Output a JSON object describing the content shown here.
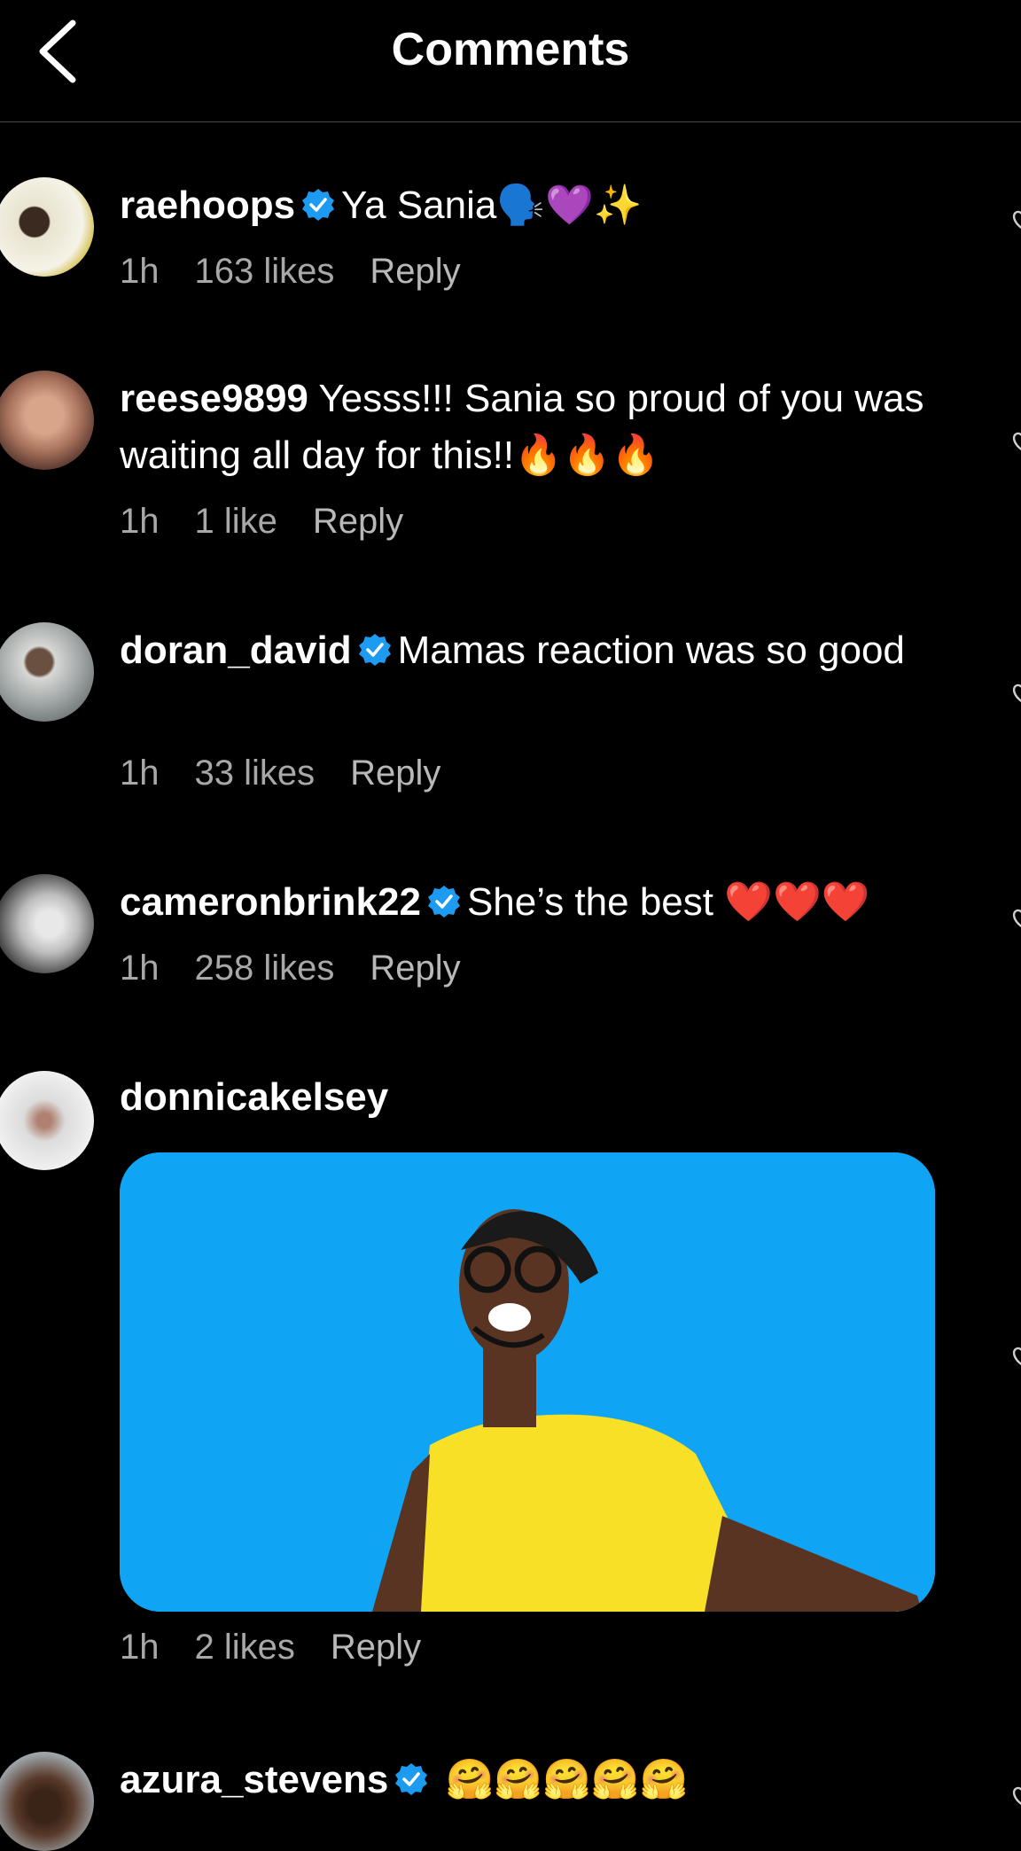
{
  "header": {
    "title": "Comments"
  },
  "comments": [
    {
      "username": "raehoops",
      "text": "Ya Sania",
      "emojis": "🗣️💜✨",
      "time": "1h",
      "likes": "163 likes",
      "reply": "Reply",
      "verified": true
    },
    {
      "username": "reese9899",
      "text": "Yesss!!! Sania so proud of you was waiting all day for this!!",
      "emojis": "🔥🔥🔥",
      "time": "1h",
      "likes": "1 like",
      "reply": "Reply",
      "verified": false
    },
    {
      "username": "doran_david",
      "text": "Mamas reaction was so good",
      "emojis": "",
      "time": "1h",
      "likes": "33 likes",
      "reply": "Reply",
      "verified": true
    },
    {
      "username": "cameronbrink22",
      "text": "She’s the best",
      "emojis": "❤️❤️❤️",
      "time": "1h",
      "likes": "258 likes",
      "reply": "Reply",
      "verified": true
    },
    {
      "username": "donnicakelsey",
      "text": "",
      "emojis": "",
      "time": "1h",
      "likes": "2 likes",
      "reply": "Reply",
      "verified": false
    },
    {
      "username": "azura_stevens",
      "text": "",
      "emojis": "🤗🤗🤗🤗🤗",
      "verified": true
    }
  ],
  "colors": {
    "background": "#000000",
    "verified": "#1d9bf0",
    "gif_background": "#0fa4f4",
    "meta_text": "#a8a8a8"
  }
}
